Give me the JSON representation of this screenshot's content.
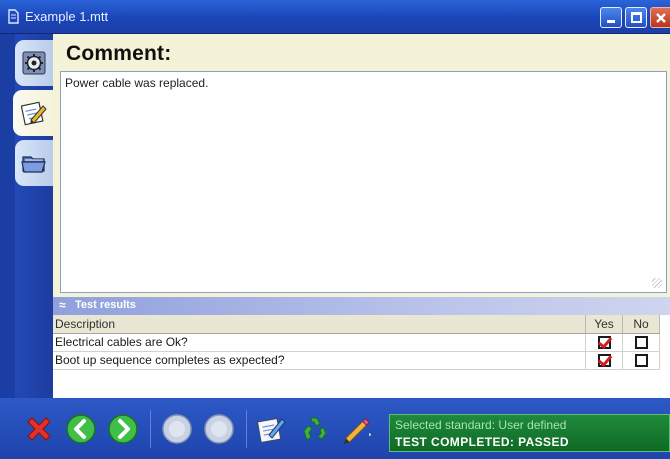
{
  "window": {
    "title": "Example 1.mtt",
    "icon": "document-icon",
    "controls": [
      "minimize-icon",
      "maximize-icon",
      "close-icon"
    ]
  },
  "sidebar": {
    "tabs": [
      {
        "name": "settings-gear-tab",
        "icon": "gear-icon",
        "active": false
      },
      {
        "name": "comment-tab",
        "icon": "pencil-note-icon",
        "active": true
      },
      {
        "name": "folder-tab",
        "icon": "folder-icon",
        "active": false
      }
    ]
  },
  "comment": {
    "heading": "Comment:",
    "text": "Power cable was replaced."
  },
  "test_results": {
    "section_label": "Test results",
    "columns": [
      "Description",
      "Yes",
      "No"
    ],
    "rows": [
      {
        "description": "Electrical cables are Ok?",
        "yes": true,
        "no": false
      },
      {
        "description": "Boot up sequence completes as expected?",
        "yes": true,
        "no": false
      }
    ]
  },
  "toolbar": {
    "buttons": [
      {
        "name": "cancel-button",
        "icon": "red-x-icon"
      },
      {
        "name": "back-button",
        "icon": "arrow-left-icon"
      },
      {
        "name": "forward-button",
        "icon": "arrow-right-icon"
      },
      {
        "name": "disabled-button-1",
        "icon": "blank-circle-icon"
      },
      {
        "name": "disabled-button-2",
        "icon": "blank-circle-icon"
      },
      {
        "name": "edit-notes-button",
        "icon": "notepad-icon"
      },
      {
        "name": "recycle-button",
        "icon": "recycle-icon"
      },
      {
        "name": "tools-button",
        "icon": "pencil-icon"
      }
    ]
  },
  "status": {
    "standard": "Selected standard: User defined",
    "result": "TEST COMPLETED: PASSED"
  },
  "colors": {
    "titlebar": "#2356cc",
    "panel": "#f5f3d7",
    "status_bg": "#1a7d34",
    "check_mark": "#d21d1d"
  }
}
